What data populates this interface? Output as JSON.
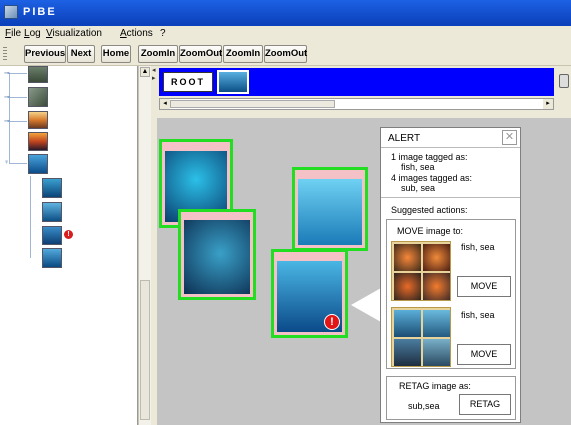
{
  "window": {
    "title": "PIBE"
  },
  "menu": [
    "File",
    "Log",
    "Visualization",
    "Actions",
    "?"
  ],
  "toolbar": [
    "Previous",
    "Next",
    "Home",
    "ZoomIn",
    "ZoomOut",
    "ZoomIn",
    "ZoomOut"
  ],
  "navigator": {
    "root_label": "ROOT"
  },
  "alert": {
    "title": "ALERT",
    "summary_line1": "1 image tagged as:",
    "summary_tags1": "fish, sea",
    "summary_line2": "4 images tagged as:",
    "summary_tags2": "sub, sea",
    "suggested_label": "Suggested actions:",
    "move_label": "MOVE image to:",
    "move_options": [
      {
        "tags": "fish, sea",
        "button": "MOVE"
      },
      {
        "tags": "fish, sea",
        "button": "MOVE"
      }
    ],
    "retag_label": "RETAG image as:",
    "retag_value": "sub,sea",
    "retag_button": "RETAG"
  },
  "colors": {
    "accent_green": "#22dd22",
    "nav_blue": "#0000ff",
    "pink_strip": "#f3c1c6",
    "canvas_gray": "#c4c4c4"
  }
}
